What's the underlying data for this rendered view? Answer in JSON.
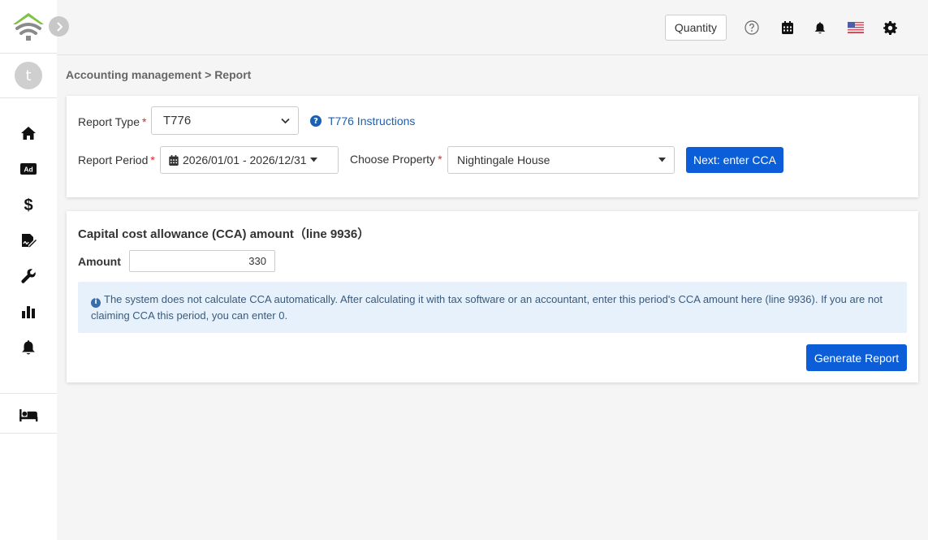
{
  "header": {
    "quantity_label": "Quantity"
  },
  "sidebar": {
    "avatar_initial": "t",
    "items": [
      {
        "icon": "home-icon"
      },
      {
        "icon": "ad-icon",
        "text": "Ad"
      },
      {
        "icon": "dollar-icon",
        "text": "$"
      },
      {
        "icon": "signature-icon"
      },
      {
        "icon": "wrench-icon"
      },
      {
        "icon": "bar-chart-icon"
      },
      {
        "icon": "bell-icon"
      },
      {
        "icon": "bed-icon"
      }
    ]
  },
  "breadcrumb": "Accounting management > Report",
  "form": {
    "report_type_label": "Report Type",
    "report_type_value": "T776",
    "instructions_link": "T776 Instructions",
    "report_period_label": "Report Period",
    "report_period_value": "2026/01/01 - 2026/12/31",
    "choose_property_label": "Choose Property",
    "property_value": "Nightingale House",
    "next_button": "Next: enter CCA",
    "required_mark": "*"
  },
  "cca": {
    "title": "Capital cost allowance (CCA) amount（line 9936）",
    "amount_label": "Amount",
    "amount_value": "330",
    "notice": "The system does not calculate CCA automatically. After calculating it with tax software or an accountant, enter this period's CCA amount here (line 9936). If you are not claiming CCA this period, you can enter 0.",
    "generate_button": "Generate Report"
  },
  "colors": {
    "primary": "#0b5ed7",
    "link": "#1a5fb4",
    "notice_bg": "#e7f1fc",
    "logo_green": "#7dc242",
    "logo_gray": "#8a8a8a"
  }
}
